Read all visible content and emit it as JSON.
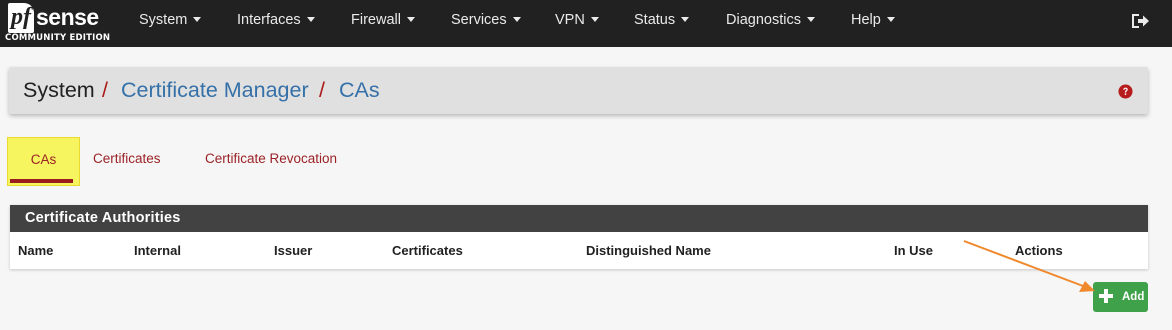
{
  "brand": {
    "logo_mark": "pf",
    "logo_word": "sense",
    "edition": "COMMUNITY EDITION"
  },
  "nav": {
    "items": [
      {
        "label": "System"
      },
      {
        "label": "Interfaces"
      },
      {
        "label": "Firewall"
      },
      {
        "label": "Services"
      },
      {
        "label": "VPN"
      },
      {
        "label": "Status"
      },
      {
        "label": "Diagnostics"
      },
      {
        "label": "Help"
      }
    ],
    "logout_icon": "sign-out-icon"
  },
  "breadcrumb": {
    "root": "System",
    "section": "Certificate Manager",
    "page": "CAs",
    "separator": "/",
    "help_icon": "question-circle-icon"
  },
  "tabs": {
    "active": "CAs",
    "items": [
      "CAs",
      "Certificates",
      "Certificate Revocation"
    ]
  },
  "table": {
    "title": "Certificate Authorities",
    "columns": [
      "Name",
      "Internal",
      "Issuer",
      "Certificates",
      "Distinguished Name",
      "In Use",
      "Actions"
    ],
    "rows": []
  },
  "actions": {
    "add_label": "Add",
    "add_icon": "plus-icon"
  },
  "colors": {
    "navbar": "#212121",
    "link": "#3571a8",
    "tab_text": "#9b2226",
    "active_tab_highlight": "#f6f45f",
    "add_button": "#3fa14a",
    "annotation_arrow": "#f0892c"
  }
}
